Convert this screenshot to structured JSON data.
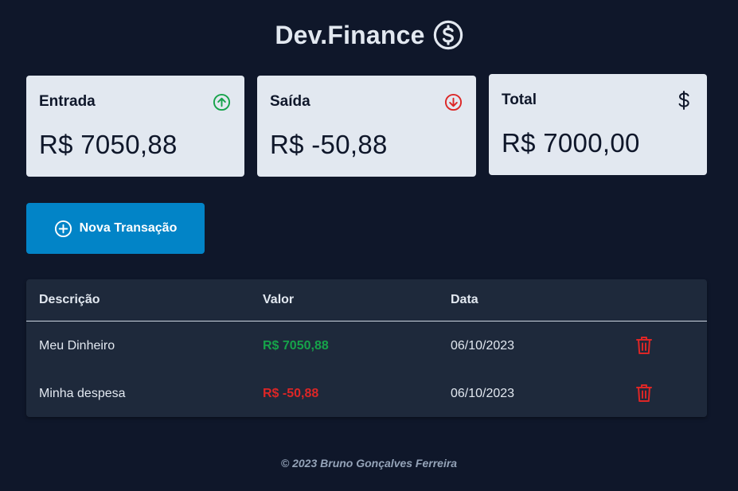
{
  "app": {
    "title": "Dev.Finance",
    "logo_icon": "dollar-circle-icon"
  },
  "colors": {
    "background": "#0f172a",
    "card": "#e2e8f0",
    "primary": "#0284c7",
    "income": "#16a34a",
    "expense": "#dc2626",
    "table": "#1e293b"
  },
  "cards": [
    {
      "title": "Entrada",
      "value": "R$ 7050,88",
      "icon": "arrow-up-circle-icon"
    },
    {
      "title": "Saída",
      "value": "R$ -50,88",
      "icon": "arrow-down-circle-icon"
    },
    {
      "title": "Total",
      "value": "R$ 7000,00",
      "icon": "dollar-icon"
    }
  ],
  "new_transaction": {
    "label": "Nova Transação",
    "icon": "plus-circle-icon"
  },
  "table": {
    "headers": [
      "Descrição",
      "Valor",
      "Data"
    ],
    "rows": [
      {
        "description": "Meu Dinheiro",
        "value": "R$ 7050,88",
        "date": "06/10/2023",
        "type": "income",
        "action_icon": "trash-icon"
      },
      {
        "description": "Minha despesa",
        "value": "R$ -50,88",
        "date": "06/10/2023",
        "type": "expense",
        "action_icon": "trash-icon"
      }
    ]
  },
  "footer": {
    "text": "© 2023 Bruno Gonçalves Ferreira"
  }
}
